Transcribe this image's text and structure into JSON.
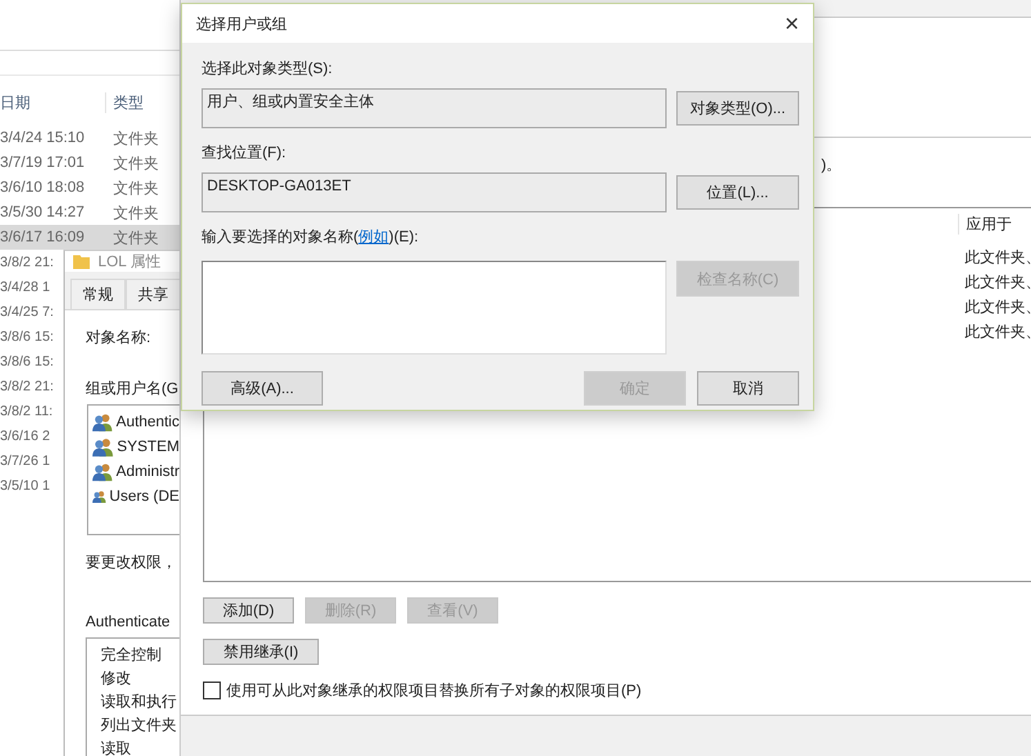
{
  "explorer": {
    "columns": [
      "日期",
      "类型"
    ],
    "rows": [
      {
        "date": "3/4/24 15:10",
        "type": "文件夹",
        "selected": false
      },
      {
        "date": "3/7/19 17:01",
        "type": "文件夹",
        "selected": false
      },
      {
        "date": "3/6/10 18:08",
        "type": "文件夹",
        "selected": false
      },
      {
        "date": "3/5/30 14:27",
        "type": "文件夹",
        "selected": false
      },
      {
        "date": "3/6/17 16:09",
        "type": "文件夹",
        "selected": true
      },
      {
        "date": "3/8/2 21:",
        "selected": false
      },
      {
        "date": "3/4/28 1",
        "selected": false
      },
      {
        "date": "3/4/25 7:",
        "selected": false
      },
      {
        "date": "3/8/6 15:",
        "selected": false
      },
      {
        "date": "3/8/6 15:",
        "selected": false
      },
      {
        "date": "3/8/2 21:",
        "selected": false
      },
      {
        "date": "3/8/2 11:",
        "selected": false
      },
      {
        "date": "3/6/16 2",
        "selected": false
      },
      {
        "date": "3/7/26 1",
        "selected": false
      },
      {
        "date": "3/5/10 1",
        "selected": false
      }
    ]
  },
  "properties_window": {
    "title": "LOL 属性",
    "tabs": [
      {
        "label": "常规",
        "selected": false
      },
      {
        "label": "共享",
        "selected": false
      }
    ],
    "object_name_label": "对象名称:",
    "groups_label": "组或用户名(G",
    "users": [
      "Authentic",
      "SYSTEM",
      "Administr",
      "Users (DE"
    ],
    "change_hint": "要更改权限，",
    "permissions_label": "Authenticate",
    "permissions": [
      "完全控制",
      "修改",
      "读取和执行",
      "列出文件夹",
      "读取"
    ]
  },
  "advanced_window": {
    "note": ")。",
    "columns": [
      "应用于"
    ],
    "rows": [
      "此文件夹、",
      "此文件夹、",
      "此文件夹、",
      "此文件夹、"
    ],
    "buttons": [
      {
        "label": "添加(D)",
        "disabled": false
      },
      {
        "label": "删除(R)",
        "disabled": true
      },
      {
        "label": "查看(V)",
        "disabled": true
      }
    ],
    "disable_inheritance": "禁用继承(I)",
    "replace_option": {
      "label": "使用可从此对象继承的权限项目替换所有子对象的权限项目(P)",
      "checked": false
    }
  },
  "dialog": {
    "title": "选择用户或组",
    "close": "×",
    "object_type_label": "选择此对象类型(S):",
    "object_type": "用户、组或内置安全主体",
    "object_type_button": "对象类型(O)...",
    "location_label": "查找位置(F):",
    "location": "DESKTOP-GA013ET",
    "location_button": "位置(L)...",
    "names_label_before": "输入要选择的对象名称(",
    "names_label_link": "例如",
    "names_label_after": ")(E):",
    "check_names": {
      "label": "检查名称(C)",
      "disabled": true
    },
    "advanced_button": "高级(A)...",
    "ok": {
      "label": "确定",
      "disabled": true
    },
    "cancel": "取消"
  }
}
